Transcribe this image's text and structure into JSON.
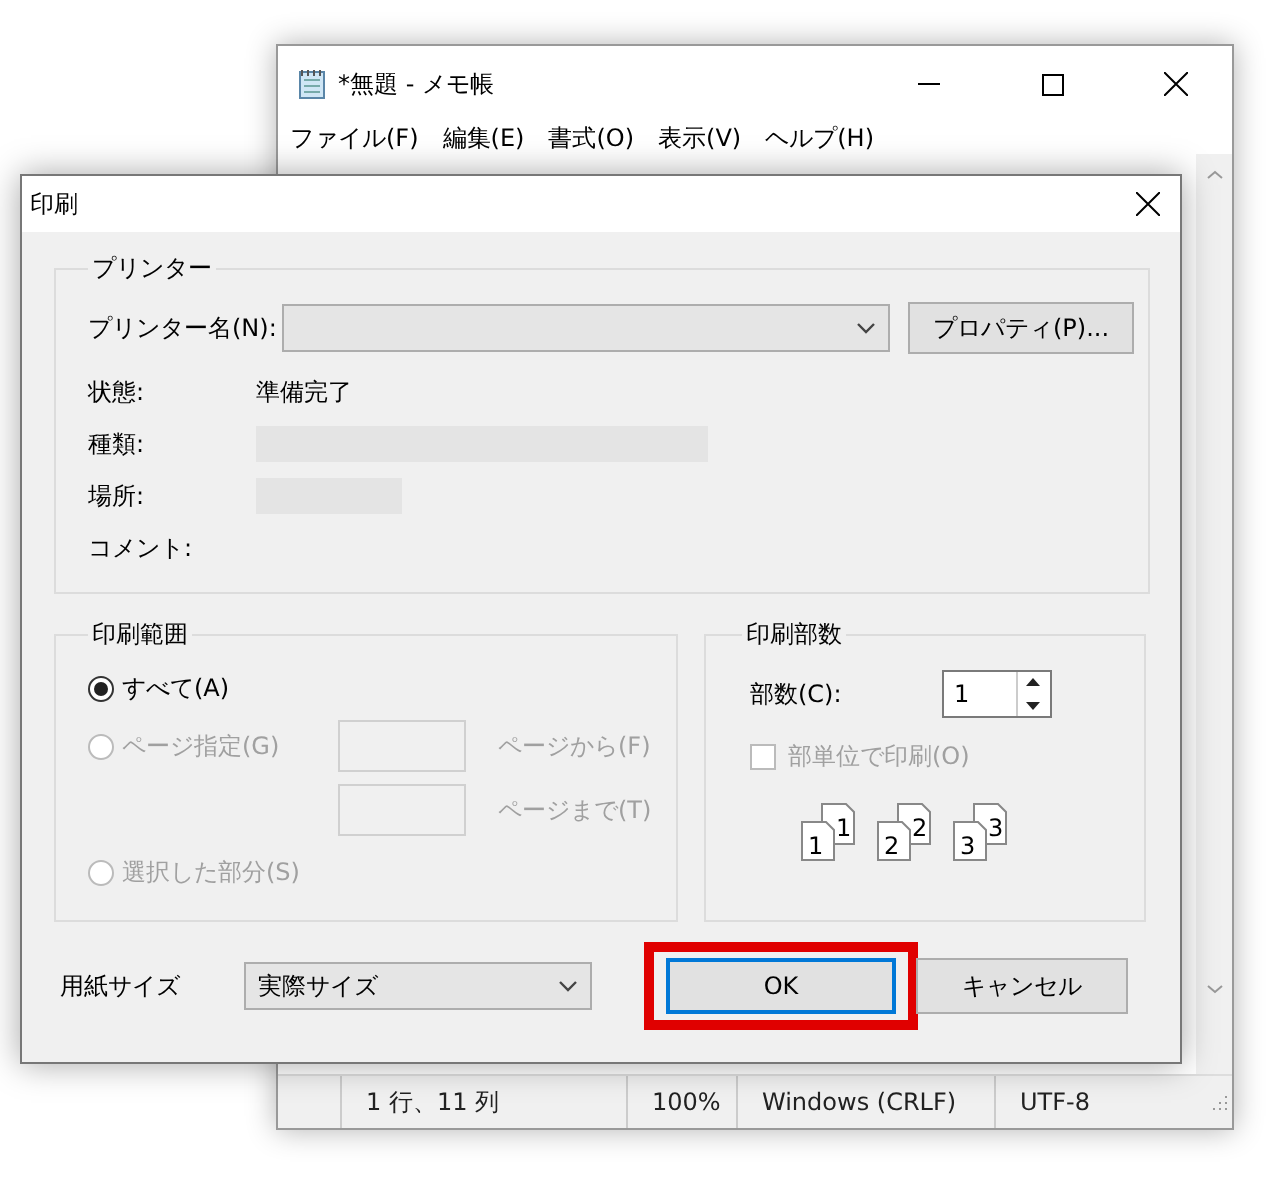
{
  "notepad": {
    "title": "*無題 - メモ帳",
    "menu": [
      "ファイル(F)",
      "編集(E)",
      "書式(O)",
      "表示(V)",
      "ヘルプ(H)"
    ],
    "status_bar": [
      "1 行、11 列",
      "100%",
      "Windows (CRLF)",
      "UTF-8"
    ]
  },
  "dialog": {
    "title": "印刷",
    "printer": {
      "label": "プリンター",
      "name_label": "プリンター名(N):",
      "properties_button": "プロパティ(P)...",
      "info": [
        {
          "label": "状態:",
          "value": "準備完了"
        },
        {
          "label": "種類:",
          "redacted": true
        },
        {
          "label": "場所:",
          "redacted": true
        },
        {
          "label": "コメント:",
          "redacted": false
        }
      ]
    },
    "range": {
      "label": "印刷範囲",
      "options": [
        {
          "label": "すべて(A)",
          "selected": true,
          "disabled": false
        },
        {
          "label": "ページ指定(G)",
          "selected": false,
          "disabled": true
        },
        {
          "label": "選択した部分(S)",
          "selected": false,
          "disabled": true
        }
      ],
      "from_label": "ページから(F)",
      "to_label": "ページまで(T)"
    },
    "copies": {
      "label": "印刷部数",
      "count_label": "部数(C):",
      "count_value": "1",
      "collate": {
        "label": "部単位で印刷(O)",
        "checked": false,
        "disabled": true
      },
      "pages": [
        {
          "back": "1",
          "front": "1"
        },
        {
          "back": "2",
          "front": "2"
        },
        {
          "back": "3",
          "front": "3"
        }
      ]
    },
    "paper_size": {
      "label": "用紙サイズ",
      "value": "実際サイズ"
    },
    "buttons": [
      {
        "label": "OK",
        "default": true,
        "highlighted": true
      },
      {
        "label": "キャンセル",
        "default": false,
        "highlighted": false
      }
    ]
  }
}
